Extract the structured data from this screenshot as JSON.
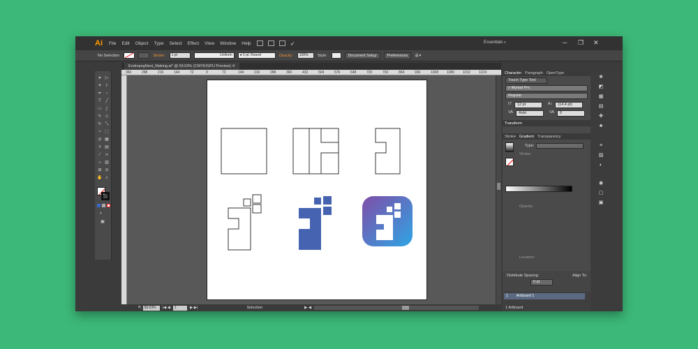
{
  "app": {
    "logo": "Ai"
  },
  "menubar": {
    "items": [
      "File",
      "Edit",
      "Object",
      "Type",
      "Select",
      "Effect",
      "View",
      "Window",
      "Help"
    ],
    "workspace": "Essentials",
    "window_controls": [
      "─",
      "❐",
      "✕"
    ]
  },
  "control_bar": {
    "selection": "No Selection",
    "stroke_label": "Stroke:",
    "stroke_value": "1 pt",
    "profile": "Uniform",
    "brush": "5 pt. Round",
    "opacity_label": "Opacity:",
    "opacity_value": "100%",
    "style_label": "Style:",
    "doc_setup": "Document Setup",
    "preferences": "Preferences"
  },
  "document": {
    "tab_title": "EndropegNext_Making.ai* @ 59.03% (CMYK/GPU Preview)"
  },
  "ruler": {
    "h_ticks": [
      "360",
      "288",
      "216",
      "144",
      "72",
      "0",
      "72",
      "144",
      "216",
      "288",
      "360",
      "432",
      "504",
      "576",
      "648",
      "720",
      "792",
      "864",
      "936",
      "1008",
      "1080",
      "1152",
      "1224"
    ]
  },
  "status_bar": {
    "zoom": "59.03%",
    "page": "1",
    "tool": "Selection"
  },
  "colors": {
    "icon_blue": "#4563b1",
    "gradient_start": "#7f4da8",
    "gradient_end": "#2fa5e4",
    "background": "#3cb878",
    "accent": "#ff9a00"
  },
  "character_panel": {
    "tabs": [
      "Character",
      "Paragraph",
      "OpenType"
    ],
    "touch_type": "Touch Type Tool",
    "font": "Myriad Pro",
    "style": "Regular",
    "size": "12 pt",
    "leading": "(14.4 pt)",
    "kerning": "Auto",
    "tracking": "0"
  },
  "transform_panel": {
    "title": "Transform"
  },
  "gradient_panel": {
    "tabs": [
      "Stroke",
      "Gradient",
      "Transparency"
    ],
    "type_label": "Type:",
    "stroke_label": "Stroke:",
    "opacity_label": "Opacity:",
    "location_label": "Location:"
  },
  "align_panel": {
    "distribute_label": "Distribute Spacing:",
    "align_to_label": "Align To:",
    "spacing_value": "0 pt"
  },
  "artboards_panel": {
    "row_num": "1",
    "row_name": "Artboard 1",
    "footer": "1 Artboard"
  }
}
